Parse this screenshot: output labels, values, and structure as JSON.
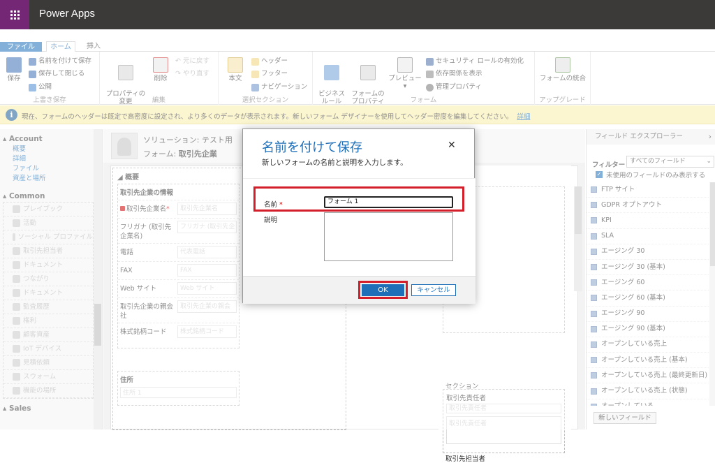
{
  "app": {
    "title": "Power Apps"
  },
  "tabs": {
    "file": "ファイル",
    "home": "ホーム",
    "insert": "挿入"
  },
  "ribbon": {
    "save": "保存",
    "save_as": "名前を付けて保存",
    "save_close": "保存して閉じる",
    "publish": "公開",
    "group_save": "上書き保存",
    "change_props": "プロパティの\n変更",
    "delete": "削除",
    "undo": "元に戻す",
    "redo": "やり直す",
    "group_edit": "編集",
    "body": "本文",
    "header": "ヘッダー",
    "footer": "フッター",
    "navigation": "ナビゲーション",
    "group_select": "選択セクション",
    "business_rules": "ビジネス\nルール",
    "form_props": "フォームの\nプロパティ",
    "preview": "プレビュー",
    "security_roles": "セキュリティ ロールの有効化",
    "dependencies": "依存関係を表示",
    "manage_props": "管理プロパティ",
    "group_form": "フォーム",
    "merge_forms": "フォームの統合",
    "group_upgrade": "アップグレード"
  },
  "infobar": {
    "text": "現在、フォームのヘッダーは既定で高密度に設定され、より多くのデータが表示されます。新しいフォーム デザイナーを使用してヘッダー密度を編集してください。",
    "link": "詳細"
  },
  "leftnav": {
    "account": "Account",
    "account_links": [
      "概要",
      "詳細",
      "ファイル",
      "資産と場所"
    ],
    "common": "Common",
    "common_items": [
      "プレイブック",
      "活動",
      "ソーシャル プロファイル",
      "取引先担当者",
      "ドキュメント",
      "つながり",
      "ドキュメント",
      "監査履歴",
      "権利",
      "顧客資産",
      "IoT デバイス",
      "見積依頼",
      "スウォーム",
      "機能の場所"
    ],
    "sales": "Sales"
  },
  "form": {
    "solution": "ソリューション: テスト用",
    "form_label": "フォーム: ",
    "form_name": "取引先企業",
    "overview": "概要",
    "company_info": "取引先企業の情報",
    "fields": [
      {
        "label": "取引先企業名",
        "required": "*",
        "placeholder": "取引先企業名"
      },
      {
        "label": "フリガナ (取引先企業名)",
        "required": "",
        "placeholder": "フリガナ (取引先企"
      },
      {
        "label": "電話",
        "required": "",
        "placeholder": "代表電話"
      },
      {
        "label": "FAX",
        "required": "",
        "placeholder": "FAX"
      },
      {
        "label": "Web サイト",
        "required": "",
        "placeholder": "Web サイト"
      },
      {
        "label": "取引先企業の親会社",
        "required": "",
        "placeholder": "取引先企業の親会"
      },
      {
        "label": "株式銘柄コード",
        "required": "",
        "placeholder": "株式銘柄コード"
      }
    ],
    "address": "住所",
    "address_placeholder": "住所 1",
    "section": "セクション",
    "primary_contact": "取引先責任者",
    "primary_contact_placeholder": "取引先責任者",
    "primary_contact_area": "取引先責任者",
    "contact_owner": "取引先担当者"
  },
  "field_explorer": {
    "title": "フィールド エクスプローラー",
    "filter_label": "フィルター",
    "filter_value": "すべてのフィールド",
    "unused_only": "未使用のフィールドのみ表示する",
    "fields": [
      "FTP サイト",
      "GDPR オプトアウト",
      "KPI",
      "SLA",
      "エージング 30",
      "エージング 30 (基本)",
      "エージング 60",
      "エージング 60 (基本)",
      "エージング 90",
      "エージング 90 (基本)",
      "オープンしている売上",
      "オープンしている売上 (基本)",
      "オープンしている売上 (最終更新日)",
      "オープンしている売上 (状態)",
      "オープンしている..."
    ],
    "new_field": "新しいフィールド"
  },
  "dialog": {
    "title": "名前を付けて保存",
    "subtitle": "新しいフォームの名前と説明を入力します。",
    "name_label": "名前",
    "required_mark": "*",
    "name_value": "フォーム 1",
    "desc_label": "説明",
    "desc_value": "",
    "ok": "OK",
    "cancel": "キャンセル"
  },
  "colors": {
    "accent": "#1e6fb8",
    "highlight": "#d41f2b",
    "topbar": "#3b3a39",
    "waffle": "#742774",
    "infobar": "#f8eeaa"
  }
}
